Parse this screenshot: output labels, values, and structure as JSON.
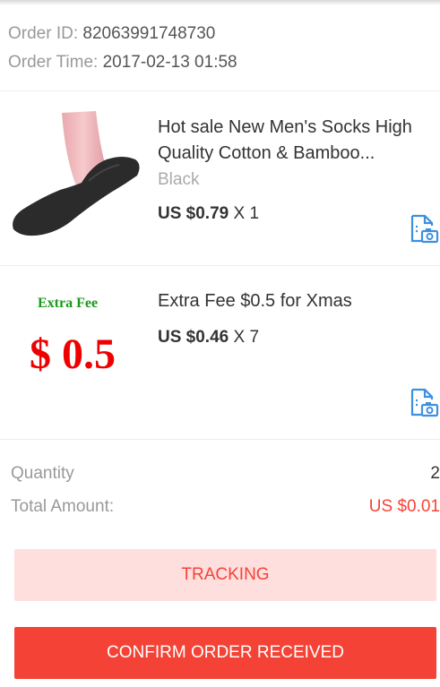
{
  "order": {
    "id_label": "Order ID:",
    "id_value": "82063991748730",
    "time_label": "Order Time:",
    "time_value": "2017-02-13 01:58"
  },
  "items": [
    {
      "title": "Hot sale New Men's Socks High Quality Cotton & Bamboo...",
      "variant": "Black",
      "price": "US $0.79",
      "quantity": "X 1",
      "thumbnail_icon": "sock-product-image"
    },
    {
      "title": "Extra Fee $0.5 for Xmas",
      "price": "US $0.46",
      "quantity": "X 7",
      "thumb_caption": "Extra Fee",
      "thumb_amount": "$ 0.5"
    }
  ],
  "summary": {
    "quantity_label": "Quantity",
    "quantity_value": "2",
    "total_label": "Total Amount:",
    "total_value": "US $0.01"
  },
  "actions": {
    "tracking_label": "TRACKING",
    "confirm_label": "CONFIRM ORDER RECEIVED"
  },
  "colors": {
    "accent": "#f44336",
    "tracking_bg": "#ffdede",
    "icon_blue": "#3d8fe0"
  }
}
